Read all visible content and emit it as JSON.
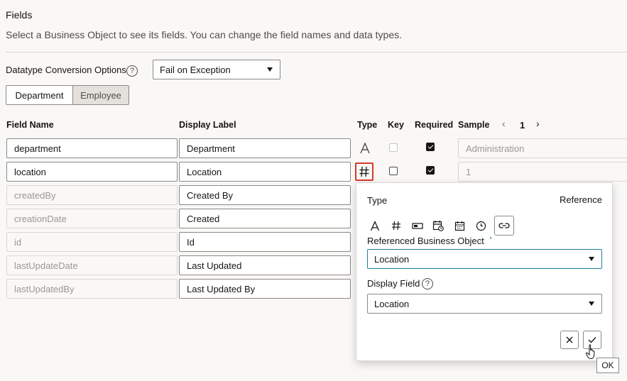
{
  "header": {
    "title": "Fields",
    "subtitle": "Select a Business Object to see its fields. You can change the field names and data types."
  },
  "conversion": {
    "label": "Datatype Conversion Options",
    "value": "Fail on Exception"
  },
  "tabs": [
    {
      "label": "Department",
      "selected": true
    },
    {
      "label": "Employee",
      "selected": false
    }
  ],
  "columns": {
    "field_name": "Field Name",
    "display_label": "Display Label",
    "type": "Type",
    "key": "Key",
    "required": "Required",
    "sample": "Sample"
  },
  "pager": {
    "page": "1"
  },
  "rows": [
    {
      "field": "department",
      "label": "Department",
      "type_icon": "text-type-icon",
      "key": false,
      "required": true,
      "sample": "Administration"
    },
    {
      "field": "location",
      "label": "Location",
      "type_icon": "number-type-icon",
      "key": false,
      "required": true,
      "sample": "1"
    },
    {
      "field": "createdBy",
      "label": "Created By"
    },
    {
      "field": "creationDate",
      "label": "Created"
    },
    {
      "field": "id",
      "label": "Id"
    },
    {
      "field": "lastUpdateDate",
      "label": "Last Updated"
    },
    {
      "field": "lastUpdatedBy",
      "label": "Last Updated By"
    }
  ],
  "popup": {
    "type_label": "Type",
    "type_value": "Reference",
    "type_icons": [
      "text-icon",
      "number-icon",
      "input-icon",
      "datetime-icon",
      "date-icon",
      "time-icon",
      "link-icon"
    ],
    "ref_bo_label": "Referenced Business Object",
    "ref_bo_required_mark": "*",
    "ref_bo_value": "Location",
    "display_field_label": "Display Field",
    "display_field_value": "Location"
  },
  "tooltip": "OK",
  "colors": {
    "accent": "#227e9e",
    "highlight": "#d63b25",
    "checkbox": "#161513"
  }
}
